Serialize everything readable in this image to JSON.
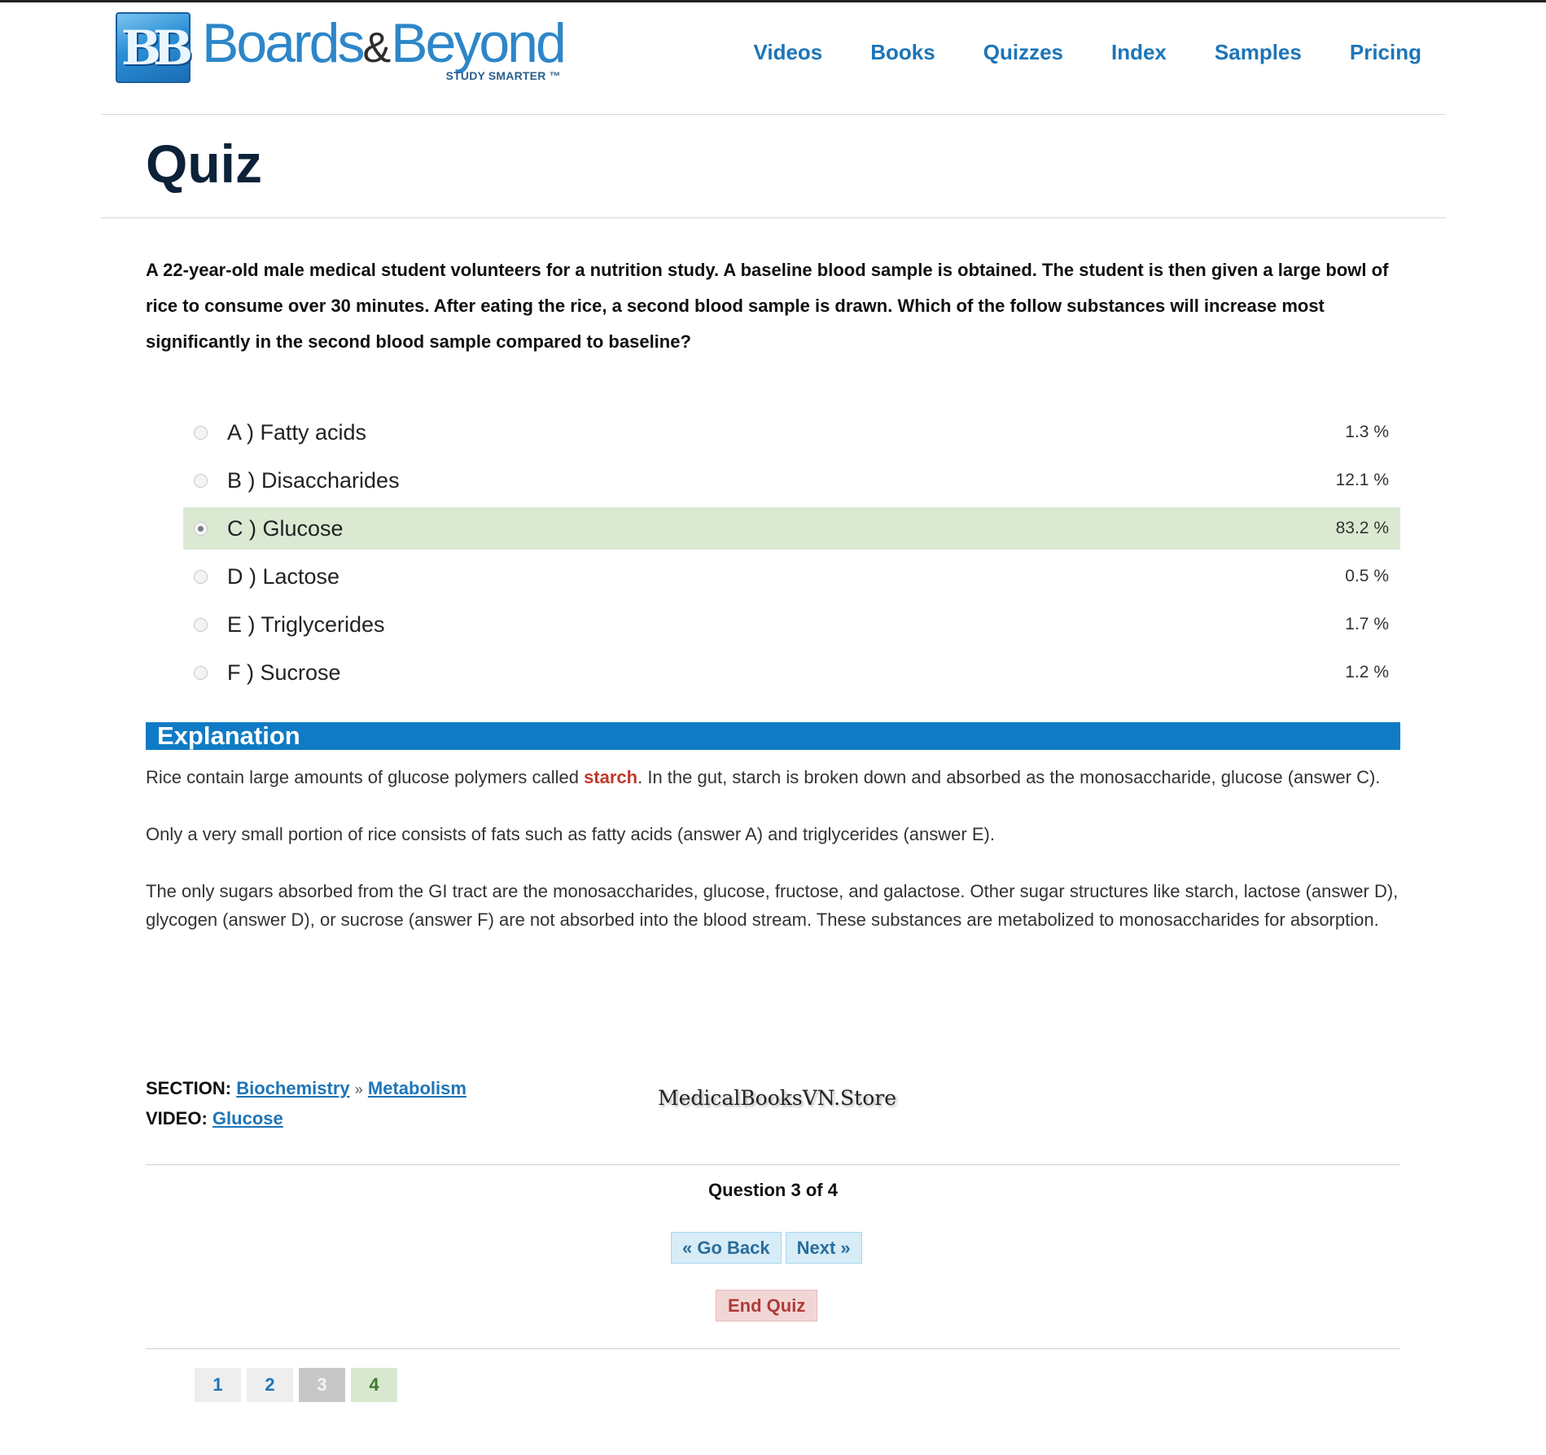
{
  "brand": {
    "badge": "BB",
    "name_part1": "Boards",
    "name_amp": "&",
    "name_part2": "Beyond",
    "tagline": "STUDY SMARTER ™"
  },
  "nav": [
    "Videos",
    "Books",
    "Quizzes",
    "Index",
    "Samples",
    "Pricing"
  ],
  "page_title": "Quiz",
  "question": "A 22-year-old male medical student volunteers for a nutrition study. A baseline blood sample is obtained. The student is then given a large bowl of rice to consume over 30 minutes. After eating the rice, a second blood sample is drawn. Which of the follow substances will increase most significantly in the second blood sample compared to baseline?",
  "answers": [
    {
      "label": "A ) Fatty acids",
      "pct": "1.3 %"
    },
    {
      "label": "B ) Disaccharides",
      "pct": "12.1 %"
    },
    {
      "label": "C ) Glucose",
      "pct": "83.2 %",
      "correct": true
    },
    {
      "label": "D ) Lactose",
      "pct": "0.5 %"
    },
    {
      "label": "E ) Triglycerides",
      "pct": "1.7 %"
    },
    {
      "label": "F ) Sucrose",
      "pct": "1.2 %"
    }
  ],
  "explanation": {
    "title": "Explanation",
    "p1_before": "Rice contain large amounts of glucose polymers called ",
    "p1_highlight": "starch",
    "p1_after": ". In the gut, starch is broken down and absorbed as the monosaccharide, glucose (answer C).",
    "p2": "Only a very small portion of rice consists of fats such as fatty acids (answer A) and triglycerides (answer E).",
    "p3": "The only sugars absorbed from the GI tract are the monosaccharides, glucose, fructose, and galactose. Other sugar structures like starch, lactose (answer D), glycogen (answer D), or sucrose (answer F) are not absorbed into the blood stream. These substances are metabolized to monosaccharides for absorption."
  },
  "meta": {
    "section_label": "SECTION:",
    "section_link1": "Biochemistry",
    "separator": "»",
    "section_link2": "Metabolism",
    "video_label": "VIDEO:",
    "video_link": "Glucose"
  },
  "watermark": "MedicalBooksVN.Store",
  "question_count": "Question 3 of 4",
  "buttons": {
    "back": "« Go Back",
    "next": "Next »",
    "end": "End Quiz"
  },
  "pager": [
    "1",
    "2",
    "3",
    "4"
  ],
  "colors": {
    "brand_blue": "#1d75b8",
    "explanation_bar": "#0f7bc4",
    "correct_row": "#dbe9d3",
    "highlight_red": "#c0392b"
  }
}
